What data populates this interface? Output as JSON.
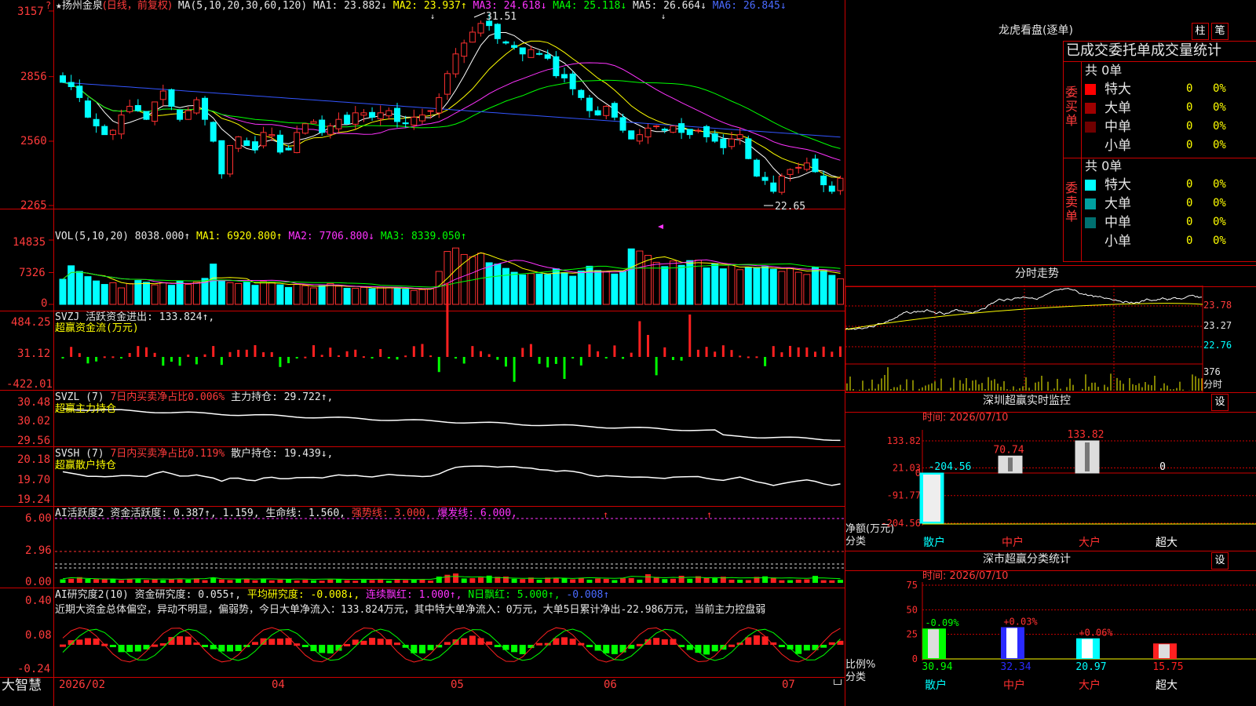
{
  "left_chart": {
    "header": {
      "star": "★",
      "name": "扬州金泉",
      "mode": "(日线，前复权)",
      "ma_label": "MA(5,10,20,30,60,120)",
      "ma1": "MA1: 23.882↓",
      "ma2": "MA2: 23.937↑",
      "ma3": "MA3: 24.618↓",
      "ma4": "MA4: 25.118↓",
      "ma5": "MA5: 26.664↓",
      "ma6": "MA6: 26.845↓"
    },
    "price_axis": [
      "3157",
      "2856",
      "2560",
      "2265"
    ],
    "annot_high": "31.51",
    "annot_low": "22.65",
    "vol": {
      "header": "VOL(5,10,20)",
      "value": "8038.000↑",
      "ma1": "MA1: 6920.800↑",
      "ma2": "MA2: 7706.800↓",
      "ma3": "MA3: 8339.050↑",
      "axis": [
        "14835",
        "7326",
        "0"
      ]
    },
    "svzj": {
      "line1a": "SVZJ",
      "line1b": "活跃资金进出: 133.824↑,",
      "line2": "超赢资金流(万元)",
      "axis": [
        "484.25",
        "31.12",
        "-422.01"
      ]
    },
    "svzl": {
      "line1a": "SVZL (7)",
      "line1b": "7日内买卖净占比0.006%",
      "line1c": "主力持仓: 29.722↑,",
      "line2": "超赢主力持仓",
      "axis": [
        "30.48",
        "30.02",
        "29.56"
      ]
    },
    "svsh": {
      "line1a": "SVSH (7)",
      "line1b": "7日内买卖净占比0.119%",
      "line1c": "散户持仓: 19.439↓,",
      "line2": "超赢散户持仓",
      "axis": [
        "20.18",
        "19.70",
        "19.24"
      ]
    },
    "ai1": {
      "a": "AI活跃度2",
      "b": "资金活跃度: 0.387↑, 1.159, 生命线: 1.560,",
      "c": "强势线: 3.000,",
      "d": "爆发线: 6.000,",
      "axis": [
        "6.00",
        "2.96",
        "0.00"
      ]
    },
    "ai2": {
      "a": "AI研究度2(10)",
      "b": "资金研究度: 0.055↑,",
      "c": "平均研究度: -0.008↓,",
      "d": "连续飘红: 1.000↑,",
      "e": "N日飘红: 5.000↑,",
      "f": "-0.008↑",
      "comment": "近期大资金总体偏空，异动不明显，偏弱势，今日大单净流入：133.824万元，其中特大单净流入：0万元，大单5日累计净出-22.986万元，当前主力控盘弱",
      "axis": [
        "0.40",
        "0.08",
        "-0.24"
      ]
    },
    "bottom": {
      "brand": "大智慧",
      "dates": [
        "2026/02",
        "04",
        "05",
        "06",
        "07"
      ]
    }
  },
  "right_panel": {
    "lhb": {
      "title": "龙虎看盘(逐单)",
      "btn_zhu": "柱",
      "btn_bi": "笔",
      "header": "已成交委托单成交量统计",
      "buy_label": [
        "委",
        "买",
        "单"
      ],
      "sell_label": [
        "委",
        "卖",
        "单"
      ],
      "buy_total": "共 0单",
      "sell_total": "共 0单",
      "buy_rows": [
        {
          "name": "特大",
          "count": "0",
          "pct": "0%",
          "color": "#ff0000"
        },
        {
          "name": "大单",
          "count": "0",
          "pct": "0%",
          "color": "#a00000"
        },
        {
          "name": "中单",
          "count": "0",
          "pct": "0%",
          "color": "#700000"
        },
        {
          "name": "小单",
          "count": "0",
          "pct": "0%",
          "color": ""
        }
      ],
      "sell_rows": [
        {
          "name": "特大",
          "count": "0",
          "pct": "0%",
          "color": "#00ffff"
        },
        {
          "name": "大单",
          "count": "0",
          "pct": "0%",
          "color": "#00a0a0"
        },
        {
          "name": "中单",
          "count": "0",
          "pct": "0%",
          "color": "#007070"
        },
        {
          "name": "小单",
          "count": "0",
          "pct": "0%",
          "color": ""
        }
      ]
    },
    "fenshi": {
      "title": "分时走势",
      "axis": [
        "23.78",
        "23.27",
        "22.76"
      ],
      "vol_label": "376",
      "vol_unit": "分时"
    },
    "sz_monitor": {
      "title": "深圳超赢实时监控",
      "btn": "设",
      "time": "时间: 2026/07/10",
      "axis": [
        "133.82",
        "21.03",
        "0",
        "-91.77",
        "-204.56"
      ],
      "ylabel_a": "净额(万元)",
      "ylabel_b": "分类",
      "categories": [
        "散户",
        "中户",
        "大户",
        "超大"
      ],
      "values": [
        -204.56,
        70.74,
        133.82,
        0
      ],
      "value_labels": [
        "-204.56",
        "70.74",
        "133.82",
        "0"
      ]
    },
    "sz_class": {
      "title": "深市超赢分类统计",
      "btn": "设",
      "time": "时间: 2026/07/10",
      "axis": [
        "75",
        "50",
        "25",
        "0"
      ],
      "ylabel_a": "比例%",
      "ylabel_b": "分类",
      "categories": [
        "散户",
        "中户",
        "大户",
        "超大"
      ],
      "values": [
        30.94,
        32.34,
        20.97,
        15.75
      ],
      "changes": [
        "-0.09%",
        "+0.03%",
        "+0.06%",
        ""
      ]
    }
  },
  "chart_data": [
    {
      "type": "candlestick",
      "title": "扬州金泉 日线 前复权",
      "xlabel": "",
      "ylabel": "",
      "x_ticks": [
        "2026/02",
        "04",
        "05",
        "06",
        "07"
      ],
      "ylim": [
        22.65,
        31.57
      ],
      "grid": false,
      "high": 31.51,
      "low": 22.65,
      "close_series": [
        28.3,
        28.1,
        27.6,
        26.7,
        26.3,
        25.9,
        26.1,
        26.8,
        27.2,
        27.0,
        26.6,
        27.4,
        27.9,
        27.2,
        26.6,
        27.0,
        27.5,
        26.6,
        25.6,
        24.1,
        25.4,
        25.8,
        25.4,
        25.2,
        26.0,
        25.9,
        25.1,
        25.2,
        26.0,
        26.4,
        26.5,
        26.0,
        26.3,
        26.6,
        26.4,
        26.9,
        26.9,
        26.7,
        26.9,
        27.0,
        26.5,
        26.4,
        26.7,
        26.8,
        27.0,
        27.6,
        28.7,
        29.6,
        30.1,
        30.6,
        31.0,
        30.9,
        30.3,
        30.1,
        29.9,
        29.6,
        29.8,
        29.6,
        29.4,
        28.6,
        28.5,
        28.0,
        27.6,
        27.0,
        26.8,
        27.2,
        26.7,
        26.1,
        25.7,
        25.9,
        26.2,
        26.3,
        26.1,
        26.3,
        26.0,
        25.9,
        26.1,
        25.8,
        25.6,
        25.3,
        25.7,
        25.9,
        24.8,
        24.0,
        23.8,
        23.3,
        24.0,
        24.3,
        24.4,
        24.6,
        24.2,
        23.6,
        23.3,
        23.9
      ]
    },
    {
      "type": "bar",
      "title": "VOL(5,10,20)",
      "ylim": [
        0,
        14835
      ],
      "series": [
        {
          "name": "MA1",
          "last": 6920.8
        },
        {
          "name": "MA2",
          "last": 7706.8
        },
        {
          "name": "MA3",
          "last": 8339.05
        }
      ],
      "values": [
        5800,
        8900,
        7600,
        6400,
        5400,
        4600,
        5000,
        3800,
        4800,
        5500,
        5100,
        4500,
        5000,
        4400,
        5400,
        4600,
        5200,
        6000,
        9300,
        5400,
        5000,
        4800,
        5100,
        4400,
        5300,
        5000,
        4500,
        3900,
        4600,
        4300,
        3800,
        4300,
        4800,
        4200,
        3700,
        3700,
        3900,
        3600,
        4000,
        3800,
        3700,
        3500,
        3200,
        3400,
        3600,
        7600,
        12200,
        13000,
        11500,
        11000,
        11800,
        9600,
        9300,
        8300,
        7400,
        6800,
        7100,
        7000,
        6900,
        8200,
        7300,
        6500,
        7700,
        8800,
        7800,
        7500,
        7000,
        7600,
        12800,
        12300,
        11300,
        9700,
        8700,
        10000,
        9000,
        10100,
        10200,
        8400,
        9400,
        8200,
        9100,
        8000,
        8500,
        8500,
        8700,
        8100,
        7600,
        8400,
        7400,
        6900,
        8500,
        7800,
        6700,
        5900
      ]
    }
  ]
}
